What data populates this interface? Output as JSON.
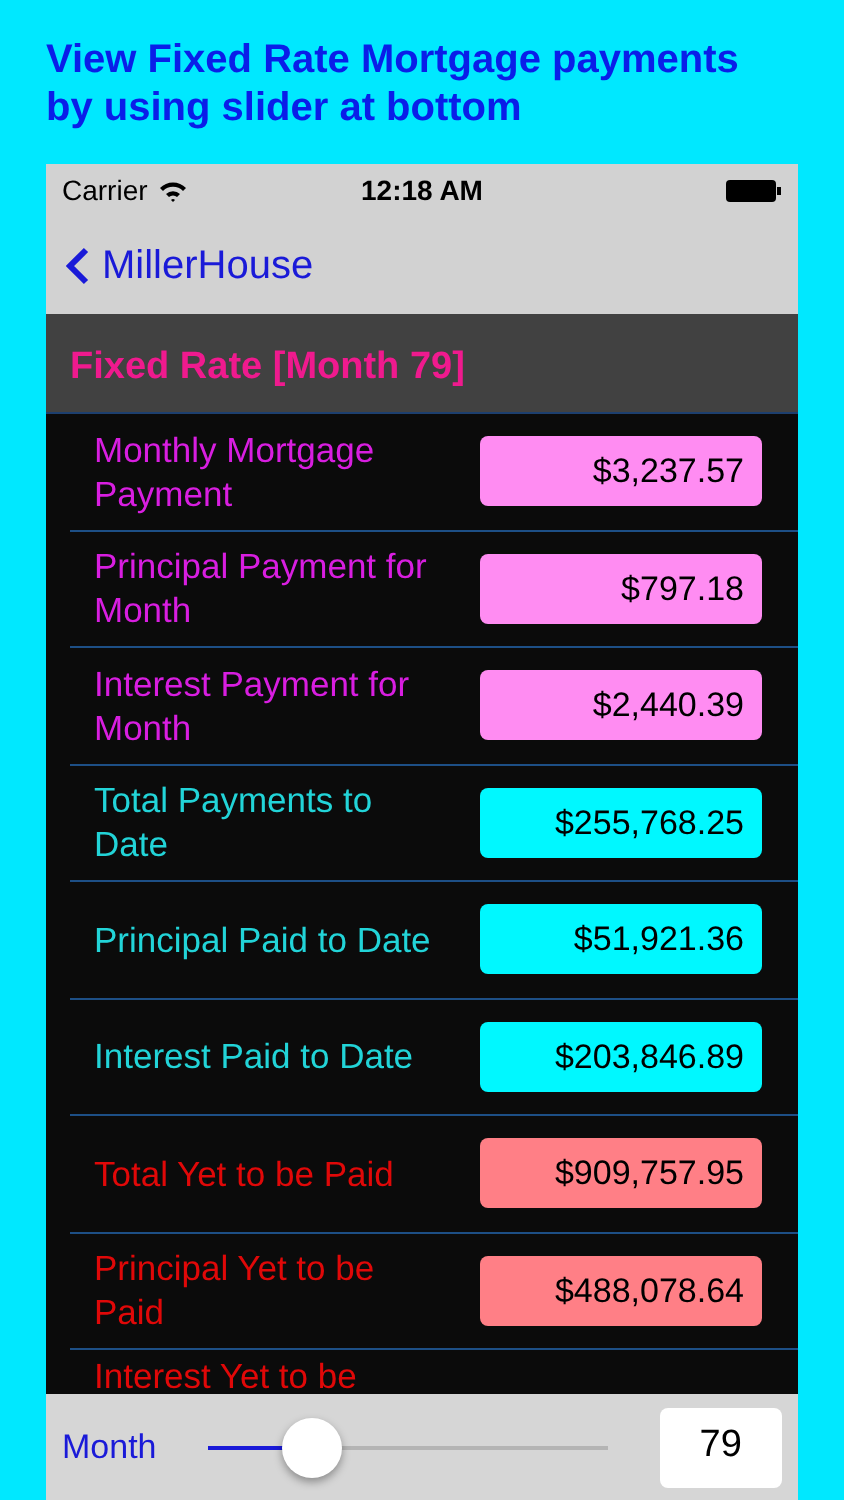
{
  "caption": "View Fixed Rate Mortgage payments by using slider at bottom",
  "status_bar": {
    "carrier": "Carrier",
    "time": "12:18 AM"
  },
  "nav": {
    "back": "MillerHouse"
  },
  "section": {
    "title": "Fixed Rate [Month 79]"
  },
  "rows": [
    {
      "kind": "payment",
      "label": "Monthly Mortgage Payment",
      "value": "$3,237.57"
    },
    {
      "kind": "payment",
      "label": "Principal Payment for Month",
      "value": "$797.18"
    },
    {
      "kind": "payment",
      "label": "Interest Payment for Month",
      "value": "$2,440.39"
    },
    {
      "kind": "paid",
      "label": "Total Payments to Date",
      "value": "$255,768.25"
    },
    {
      "kind": "paid",
      "label": "Principal Paid to Date",
      "value": "$51,921.36"
    },
    {
      "kind": "paid",
      "label": "Interest Paid to Date",
      "value": "$203,846.89"
    },
    {
      "kind": "remaining",
      "label": "Total Yet to be Paid",
      "value": "$909,757.95"
    },
    {
      "kind": "remaining",
      "label": "Principal Yet to be Paid",
      "value": "$488,078.64"
    },
    {
      "kind": "remaining",
      "label": "Interest Yet to be"
    }
  ],
  "toolbar": {
    "label": "Month",
    "slider": {
      "level": 0.26
    },
    "value": "79"
  }
}
